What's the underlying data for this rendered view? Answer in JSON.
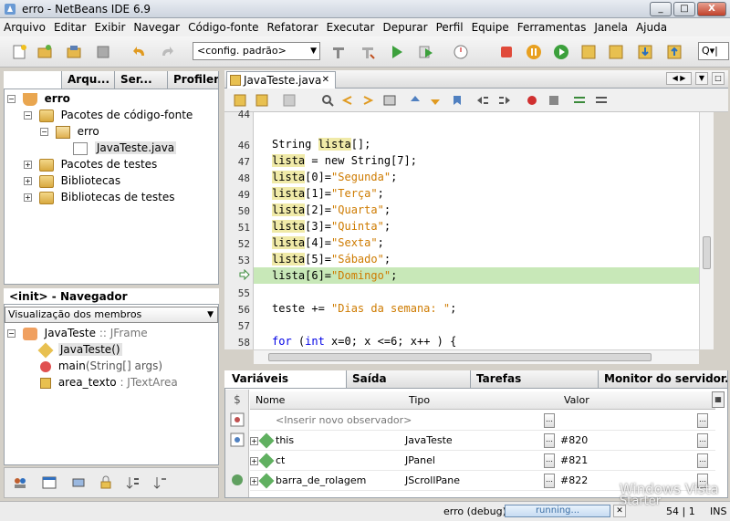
{
  "window": {
    "title": "erro - NetBeans IDE 6.9",
    "minimize": "_",
    "maximize": "□",
    "close": "X"
  },
  "menu": [
    "Arquivo",
    "Editar",
    "Exibir",
    "Navegar",
    "Código-fonte",
    "Refatorar",
    "Executar",
    "Depurar",
    "Perfil",
    "Equipe",
    "Ferramentas",
    "Janela",
    "Ajuda"
  ],
  "toolbar": {
    "config": "<config. padrão>",
    "search_placeholder": "Q▾|"
  },
  "projects": {
    "tabs": [
      "Arqu...",
      "Ser...",
      "Profiler"
    ],
    "tree": {
      "root": "erro",
      "source_packages": "Pacotes de código-fonte",
      "package": "erro",
      "file": "JavaTeste.java",
      "test_packages": "Pacotes de testes",
      "libraries": "Bibliotecas",
      "test_libraries": "Bibliotecas de testes"
    }
  },
  "navigator": {
    "title": "<init> - Navegador",
    "view": "Visualização dos membros",
    "class_name": "JavaTeste",
    "class_type": " :: JFrame",
    "constructor": "JavaTeste()",
    "method_name": "main",
    "method_params": "(String[] args)",
    "field_name": "area_texto",
    "field_type": " : JTextArea"
  },
  "editor": {
    "tab": "JavaTeste.java",
    "lines": [
      {
        "n": "44",
        "code": ""
      },
      {
        "n": "46",
        "pre": "String ",
        "hl": "lista",
        "post": "[];"
      },
      {
        "n": "47",
        "hl": "lista",
        "post": " = new String[7];"
      },
      {
        "n": "48",
        "hl": "lista",
        "post": "[0]=",
        "str": "\"Segunda\"",
        "end": ";"
      },
      {
        "n": "49",
        "hl": "lista",
        "post": "[1]=",
        "str": "\"Terça\"",
        "end": ";"
      },
      {
        "n": "50",
        "hl": "lista",
        "post": "[2]=",
        "str": "\"Quarta\"",
        "end": ";"
      },
      {
        "n": "51",
        "hl": "lista",
        "post": "[3]=",
        "str": "\"Quinta\"",
        "end": ";"
      },
      {
        "n": "52",
        "hl": "lista",
        "post": "[4]=",
        "str": "\"Sexta\"",
        "end": ";"
      },
      {
        "n": "53",
        "hl": "lista",
        "post": "[5]=",
        "str": "\"Sábado\"",
        "end": ";"
      },
      {
        "n": "",
        "hl": "lista",
        "post": "[6]=",
        "str": "\"Domingo\"",
        "end": ";"
      },
      {
        "n": "55",
        "code": ""
      },
      {
        "n": "56",
        "pre": "teste += ",
        "str": "\"Dias da semana: \"",
        "end": ";"
      },
      {
        "n": "57",
        "code": ""
      },
      {
        "n": "58",
        "kw": "for",
        "post": " (",
        "kw2": "int",
        "end": " x=0; x <=6; x++ ) {"
      }
    ]
  },
  "bottom": {
    "tabs": [
      "Variáveis",
      "Saída",
      "Tarefas",
      "Monitor do servidor..."
    ],
    "columns": [
      "Nome",
      "Tipo",
      "Valor"
    ],
    "placeholder": "<Inserir novo observador>",
    "rows": [
      {
        "name": "this",
        "type": "JavaTeste",
        "value": "#820"
      },
      {
        "name": "ct",
        "type": "JPanel",
        "value": "#821"
      },
      {
        "name": "barra_de_rolagem",
        "type": "JScrollPane",
        "value": "#822"
      }
    ]
  },
  "status": {
    "session": "erro (debug)",
    "progress": "running...",
    "position": "54 | 1",
    "mode": "INS"
  },
  "watermark": {
    "line1": "Windows Vista",
    "line2": "Starter"
  }
}
